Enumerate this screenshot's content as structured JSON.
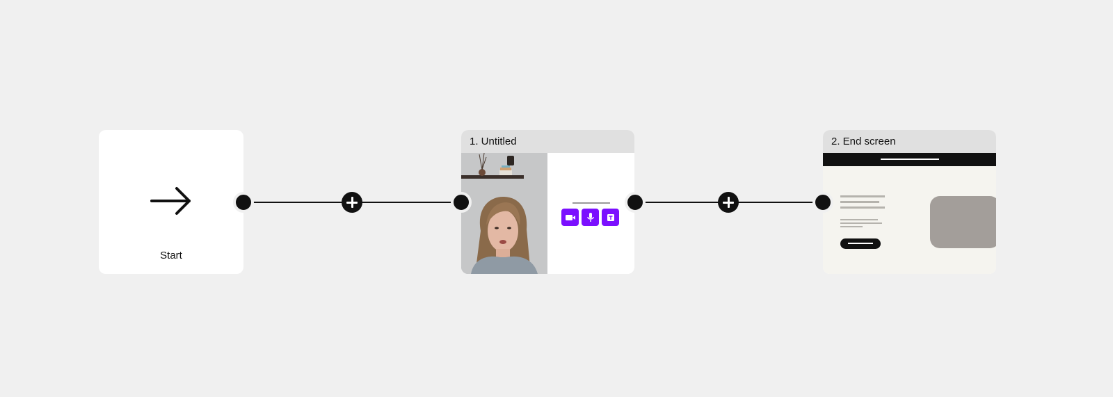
{
  "start_node": {
    "label": "Start",
    "icon": "arrow-right-icon"
  },
  "steps": [
    {
      "title": "1. Untitled",
      "thumbnail": "video-recording-thumbnail",
      "response_options": [
        {
          "icon": "video-camera-icon"
        },
        {
          "icon": "microphone-icon"
        },
        {
          "icon": "text-icon"
        }
      ]
    },
    {
      "title": "2. End screen",
      "thumbnail": "end-screen-thumbnail"
    }
  ],
  "connectors": [
    {
      "add_icon": "plus-icon"
    },
    {
      "add_icon": "plus-icon"
    }
  ],
  "colors": {
    "background": "#f0f0f0",
    "accent": "#7b0fff",
    "line": "#111111",
    "header": "#e0e0e0"
  }
}
